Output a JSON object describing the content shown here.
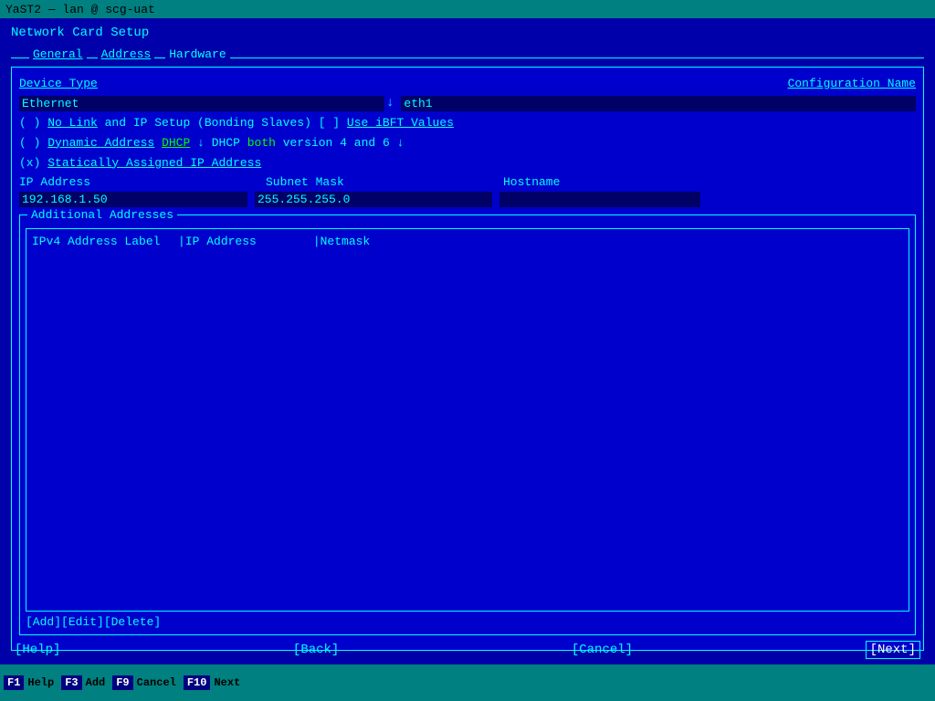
{
  "titlebar": {
    "text": "YaST2 — lan @ scg-uat"
  },
  "page": {
    "title": "Network Card Setup"
  },
  "tabs": {
    "general": "General",
    "address": "Address",
    "hardware": "Hardware"
  },
  "form": {
    "device_type_label": "Device Type",
    "config_name_label": "Configuration Name",
    "device_type_value": "Ethernet",
    "config_name_value": "eth1",
    "radio_no_link": "( ) No Link and IP Setup (Bonding Slaves)",
    "radio_no_link_prefix": "( )",
    "radio_no_link_text": "No Link",
    "radio_no_link_and": "and",
    "radio_no_link_rest": "IP Setup (Bonding Slaves)",
    "use_ibft_bracket": "[ ]",
    "use_ibft_text": "Use iBFT Values",
    "radio_dynamic_prefix": "( )",
    "radio_dynamic_label": "Dynamic Address",
    "dhcp_value": "DHCP",
    "dhcp_rest": "DHCP both version 4 and 6",
    "radio_static_prefix": "(x)",
    "radio_static_text": "Statically Assigned IP Address",
    "ip_address_label": "IP Address",
    "subnet_mask_label": "Subnet Mask",
    "hostname_label": "Hostname",
    "ip_address_value": "192.168.1.50",
    "subnet_mask_value": "255.255.255.0",
    "hostname_value": ""
  },
  "additional": {
    "section_title": "Additional Addresses",
    "table_headers": {
      "ipv4_label": "IPv4 Address Label",
      "ip_address": "IP Address",
      "netmask": "Netmask"
    },
    "buttons": {
      "add": "[Add]",
      "edit": "[Edit]",
      "delete": "[Delete]"
    }
  },
  "bottom_buttons": {
    "help": "[Help]",
    "back": "[Back]",
    "cancel": "[Cancel]",
    "next": "[Next]"
  },
  "fkeys": [
    {
      "num": "F1",
      "label": "Help"
    },
    {
      "num": "F3",
      "label": "Add"
    },
    {
      "num": "F9",
      "label": "Cancel"
    },
    {
      "num": "F10",
      "label": "Next"
    }
  ]
}
